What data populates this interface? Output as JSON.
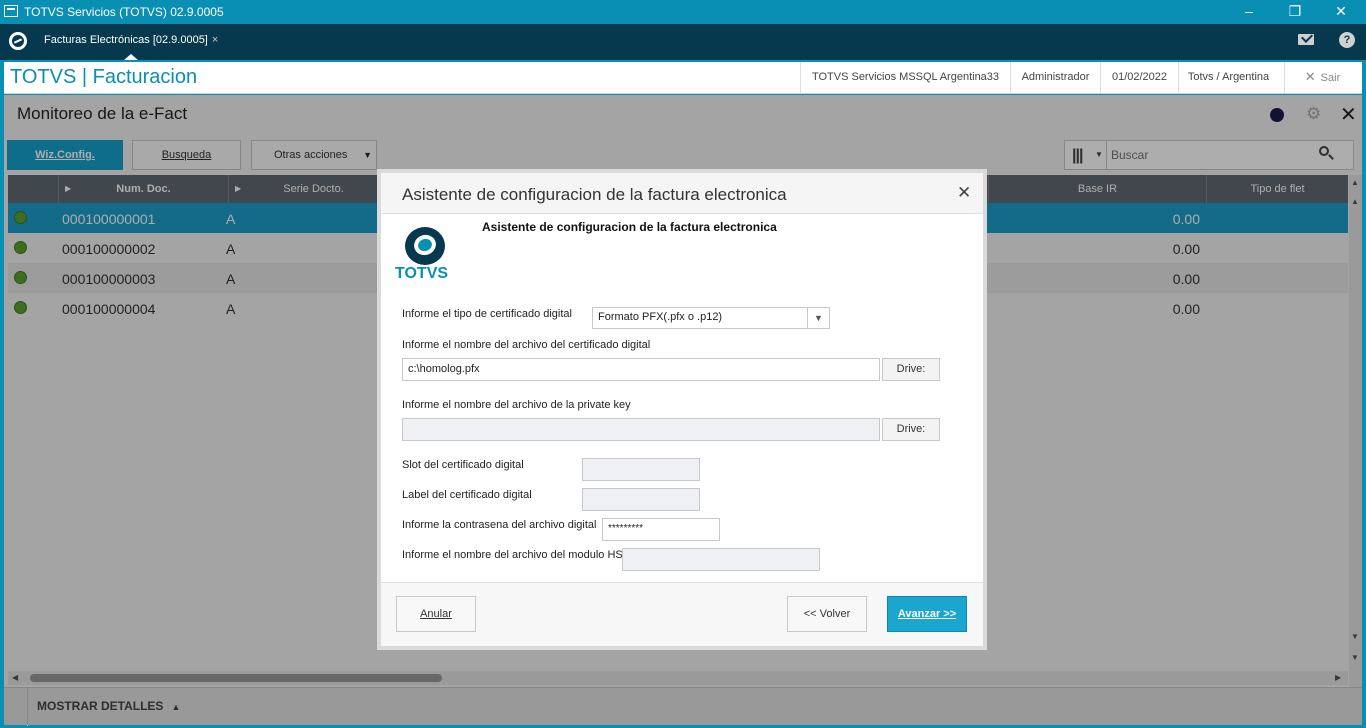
{
  "window": {
    "title": "TOTVS Servicios (TOTVS) 02.9.0005"
  },
  "tabs": [
    {
      "label": "Facturas Electrónicas [02.9.0005]",
      "close": "×"
    }
  ],
  "appbar": {
    "brand": "TOTVS | Facturacion",
    "environment": "TOTVS Servicios MSSQL Argentina33",
    "user": "Administrador",
    "date": "01/02/2022",
    "company": "Totvs / Argentina",
    "exit_label": "Sair"
  },
  "page": {
    "title": "Monitoreo de la e-Fact",
    "buttons": {
      "wiz": "Wiz.Config.",
      "busqueda": "Busqueda",
      "otras": "Otras acciones"
    },
    "search_placeholder": "Buscar"
  },
  "table": {
    "headers": [
      "Num. Doc.",
      "Serie Docto.",
      "Base IR",
      "Tipo de flet"
    ],
    "rows": [
      {
        "num": "000100000001",
        "serie": "A",
        "base": "0.00"
      },
      {
        "num": "000100000002",
        "serie": "A",
        "base": "0.00"
      },
      {
        "num": "000100000003",
        "serie": "A",
        "base": "0.00"
      },
      {
        "num": "000100000004",
        "serie": "A",
        "base": "0.00"
      }
    ]
  },
  "footer": {
    "label": "MOSTRAR DETALLES"
  },
  "dialog": {
    "title": "Asistente de configuracion de la factura electronica",
    "heading": "Asistente de configuracion de la factura electronica",
    "logo_text": "TOTVS",
    "cert_type_label": "Informe el tipo de certificado digital",
    "cert_type_value": "Formato PFX(.pfx o .p12)",
    "cert_file_label": "Informe el nombre del archivo del certificado digital",
    "cert_file_value": "c:\\homolog.pfx",
    "drive_label": "Drive:",
    "key_file_label": "Informe el nombre del archivo de la private key",
    "key_file_value": "",
    "slot_label": "Slot del certificado digital",
    "cert_label_label": "Label del certificado digital",
    "password_label": "Informe la contrasena del archivo digital",
    "password_value": "*********",
    "hsm_label": "Informe el nombre del archivo del modulo HSM",
    "buttons": {
      "cancel": "Anular",
      "back": "<< Volver",
      "next": "Avanzar >>"
    }
  },
  "colors": {
    "brand": "#0a8fb4",
    "selected_row": "#1d9ccb",
    "primary_button": "#1aa6cf"
  }
}
